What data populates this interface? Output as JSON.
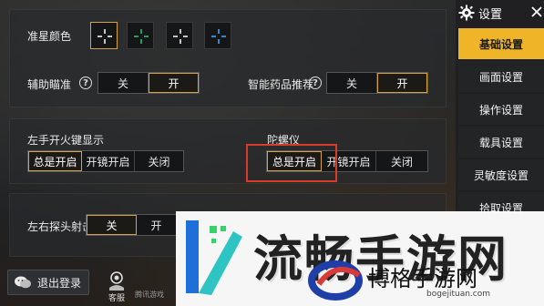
{
  "sidebar": {
    "title": "设置",
    "items": [
      {
        "label": "基础设置",
        "active": true
      },
      {
        "label": "画面设置",
        "active": false
      },
      {
        "label": "操作设置",
        "active": false
      },
      {
        "label": "载具设置",
        "active": false
      },
      {
        "label": "灵敏度设置",
        "active": false
      },
      {
        "label": "拾取设置",
        "active": false
      }
    ],
    "accent": "#f0b429"
  },
  "crosshair": {
    "label": "准星颜色",
    "colors": [
      "#ffffff",
      "#2ecc71",
      "#ffffff",
      "#3ab0ff"
    ],
    "selected_index": 0
  },
  "assist_aim": {
    "label": "辅助瞄准",
    "options": [
      "关",
      "开"
    ],
    "selected": "开"
  },
  "smart_medicine": {
    "label": "智能药品推荐",
    "options": [
      "关",
      "开"
    ],
    "selected": "开"
  },
  "left_fire": {
    "label": "左手开火键显示",
    "options": [
      "总是开启",
      "开镜开启",
      "关闭"
    ],
    "selected": "总是开启"
  },
  "gyroscope": {
    "label": "陀螺仪",
    "options": [
      "总是开启",
      "开镜开启",
      "关闭"
    ],
    "selected": "总是开启"
  },
  "lean_fire": {
    "label": "左右探头射击",
    "options": [
      "关",
      "开"
    ],
    "selected": "关"
  },
  "bottom": {
    "logout": "退出登录",
    "service": "客服",
    "caption": "腾讯游戏"
  },
  "watermark": {
    "big": "流畅手游网",
    "small": "博格手游网",
    "url": "bogejituan.com"
  },
  "colors": {
    "highlight": "#d6a23a",
    "annotation": "#d93a2a"
  }
}
